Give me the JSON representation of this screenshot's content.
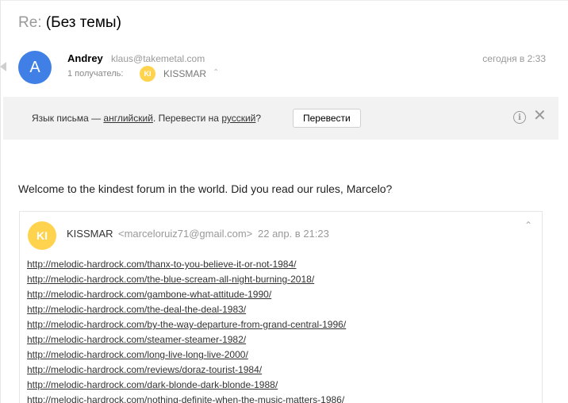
{
  "message": {
    "subject_prefix": "Re:",
    "subject": "(Без темы)",
    "sender": {
      "avatar_letter": "A",
      "name": "Andrey",
      "email": "klaus@takemetal.com",
      "date": "сегодня в 2:33"
    },
    "recipients": {
      "label": "1 получатель:",
      "avatar_initials": "KI",
      "name": "KISSMAR"
    },
    "translate": {
      "text_before": "Язык письма — ",
      "lang_from": "английский",
      "text_middle": ". Перевести на ",
      "lang_to": "русский",
      "text_after": "?",
      "button_label": "Перевести",
      "info_glyph": "i",
      "close_glyph": "✕"
    },
    "body": "Welcome to the kindest forum in the world. Did you read our rules, Marcelo?",
    "quoted": {
      "avatar_initials": "KI",
      "name": "KISSMAR",
      "email": "<marceloruiz71@gmail.com>",
      "date": "22 апр. в 21:23",
      "links": [
        "http://melodic-hardrock.com/thanx-to-you-believe-it-or-not-1984/",
        "http://melodic-hardrock.com/the-blue-scream-all-night-burning-2018/",
        "http://melodic-hardrock.com/gambone-what-attitude-1990/",
        "http://melodic-hardrock.com/the-deal-the-deal-1983/",
        "http://melodic-hardrock.com/by-the-way-departure-from-grand-central-1996/",
        "http://melodic-hardrock.com/steamer-steamer-1982/",
        "http://melodic-hardrock.com/long-live-long-live-2000/",
        "http://melodic-hardrock.com/reviews/doraz-tourist-1984/",
        "http://melodic-hardrock.com/dark-blonde-dark-blonde-1988/",
        "http://melodic-hardrock.com/nothing-definite-when-the-music-matters-1986/"
      ]
    }
  },
  "icons": {
    "collapse": "collapse-arrow-icon",
    "info": "info-icon",
    "close": "close-icon",
    "caret_up": "chevron-up-icon"
  },
  "colors": {
    "avatar_a": "#3f7fe6",
    "avatar_ki": "#ffd34e",
    "translate_bar_bg": "#f2f2f2"
  }
}
